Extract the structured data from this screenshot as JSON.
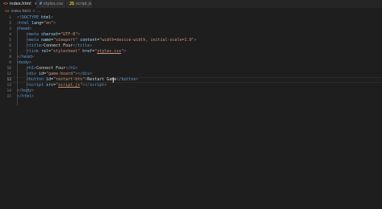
{
  "tabs": [
    {
      "label": "index.html",
      "icon": "html-file-icon",
      "active": true
    },
    {
      "label": "styles.css",
      "icon": "css-file-icon",
      "active": false
    },
    {
      "label": "script.js",
      "icon": "js-file-icon",
      "active": false
    }
  ],
  "tab_close_glyph": "×",
  "breadcrumb": {
    "file": "index.html",
    "separator": ">",
    "symbol": "..."
  },
  "line_numbers": [
    "1",
    "2",
    "3",
    "4",
    "5",
    "6",
    "7",
    "8",
    "9",
    "10",
    "11",
    "12",
    "13",
    "14",
    "15"
  ],
  "code": {
    "l1": {
      "open": "<!",
      "tag": "DOCTYPE",
      "sp": " ",
      "attr": "html",
      "close": ">"
    },
    "l2": {
      "open": "<",
      "tag": "html",
      "sp": " ",
      "attr": "lang",
      "eq": "=",
      "val": "\"en\"",
      "close": ">"
    },
    "l3": {
      "open": "<",
      "tag": "head",
      "close": ">"
    },
    "l4": {
      "open": "<",
      "tag": "meta",
      "sp": " ",
      "attr": "charset",
      "eq": "=",
      "val": "\"UTF-8\"",
      "close": ">"
    },
    "l5": {
      "open": "<",
      "tag": "meta",
      "sp": " ",
      "attr1": "name",
      "eq1": "=",
      "val1": "\"viewport\"",
      "sp2": " ",
      "attr2": "content",
      "eq2": "=",
      "val2": "\"width=device-width, initial-scale=1.0\"",
      "close": ">"
    },
    "l6": {
      "open": "<",
      "tag": "title",
      "close": ">",
      "text": "Connect Four",
      "open2": "</",
      "tag2": "title",
      "close2": ">"
    },
    "l7": {
      "open": "<",
      "tag": "link",
      "sp": " ",
      "attr1": "rel",
      "eq1": "=",
      "val1": "\"stylesheet\"",
      "sp2": " ",
      "attr2": "href",
      "eq2": "=",
      "q1": "\"",
      "link": "styles.css",
      "q2": "\"",
      "close": ">"
    },
    "l8": {
      "open": "</",
      "tag": "head",
      "close": ">"
    },
    "l9": {
      "open": "<",
      "tag": "body",
      "close": ">"
    },
    "l10": {
      "open": "<",
      "tag": "h1",
      "close": ">",
      "text": "Connect Four",
      "open2": "</",
      "tag2": "h1",
      "close2": ">"
    },
    "l11": {
      "open": "<",
      "tag": "div",
      "sp": " ",
      "attr": "id",
      "eq": "=",
      "val": "\"game-board\"",
      "close": ">",
      "open2": "</",
      "tag2": "div",
      "close2": ">"
    },
    "l12": {
      "open": "<",
      "tag": "button",
      "sp": " ",
      "attr": "id",
      "eq": "=",
      "val": "\"restart-btn\"",
      "close": ">",
      "text": "Restart Game",
      "open2": "</",
      "tag2": "button",
      "close2": ">"
    },
    "l13": {
      "open": "<",
      "tag": "script",
      "sp": " ",
      "attr": "src",
      "eq": "=",
      "q1": "\"",
      "link": "script.js",
      "q2": "\"",
      "close": ">",
      "open2": "</",
      "tag2": "script",
      "close2": ">"
    },
    "l14": {
      "open": "</",
      "tag": "body",
      "close": ">"
    },
    "l15": {
      "open": "</",
      "tag": "html",
      "close": ">"
    }
  },
  "colors": {
    "background": "#1e1e1e",
    "tag": "#569cd6",
    "attribute": "#9cdcfe",
    "string": "#ce9178",
    "punctuation": "#808080",
    "text": "#d4d4d4",
    "html_icon": "#e37933",
    "css_icon": "#42a5f5",
    "js_icon": "#f5de19"
  }
}
